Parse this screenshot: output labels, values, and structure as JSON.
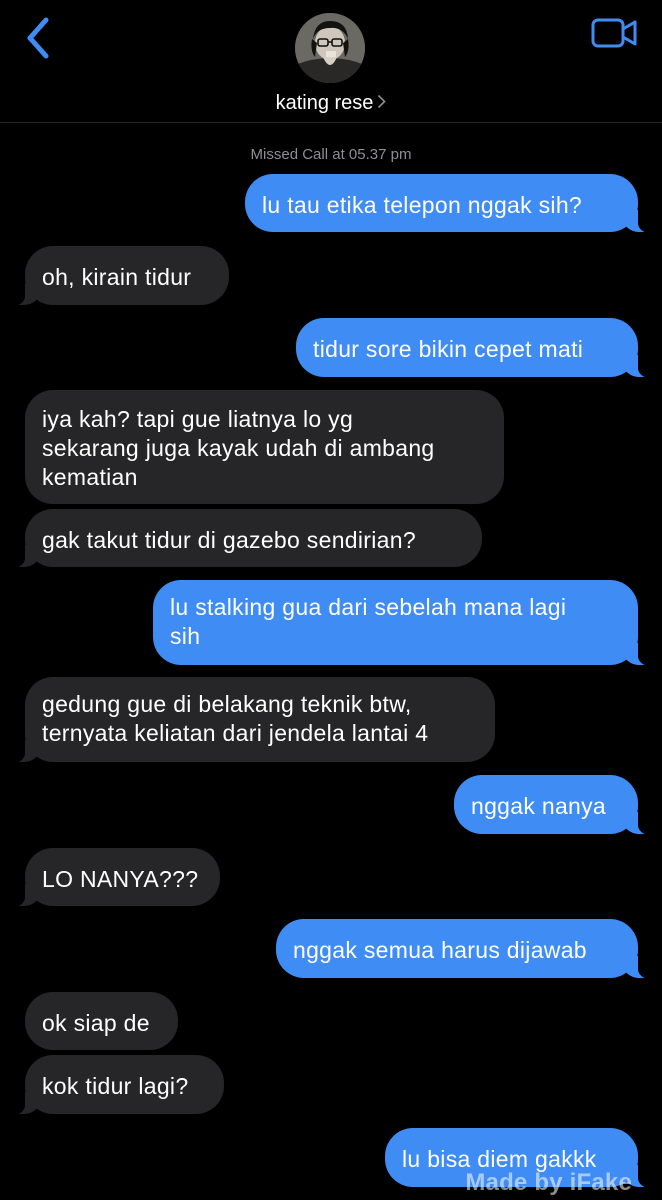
{
  "header": {
    "contact_name": "kating rese",
    "back_icon": "chevron-left-icon",
    "video_icon": "video-camera-icon",
    "accent_color": "#3f8cf5"
  },
  "status": {
    "missed_call": "Missed Call at 05.37 pm"
  },
  "messages": [
    {
      "from": "me",
      "lines": [
        "lu tau etika telepon nggak sih?"
      ]
    },
    {
      "from": "them",
      "lines": [
        "oh, kirain tidur"
      ]
    },
    {
      "from": "me",
      "lines": [
        "tidur sore bikin cepet mati"
      ]
    },
    {
      "from": "them",
      "lines": [
        "iya kah? tapi gue liatnya lo yg",
        "sekarang juga kayak udah di ambang",
        "kematian"
      ]
    },
    {
      "from": "them",
      "lines": [
        "gak takut tidur di gazebo sendirian?"
      ]
    },
    {
      "from": "me",
      "lines": [
        "lu stalking gua dari sebelah mana lagi",
        "sih"
      ]
    },
    {
      "from": "them",
      "lines": [
        "gedung gue di belakang teknik btw,",
        "ternyata keliatan dari jendela lantai 4"
      ]
    },
    {
      "from": "me",
      "lines": [
        "nggak nanya"
      ]
    },
    {
      "from": "them",
      "lines": [
        "LO NANYA???"
      ]
    },
    {
      "from": "me",
      "lines": [
        "nggak semua harus dijawab"
      ]
    },
    {
      "from": "them",
      "lines": [
        "ok siap de"
      ]
    },
    {
      "from": "them",
      "lines": [
        "kok tidur lagi?"
      ]
    },
    {
      "from": "me",
      "lines": [
        "lu bisa diem gakkk"
      ]
    }
  ],
  "watermark": "Made by iFake"
}
